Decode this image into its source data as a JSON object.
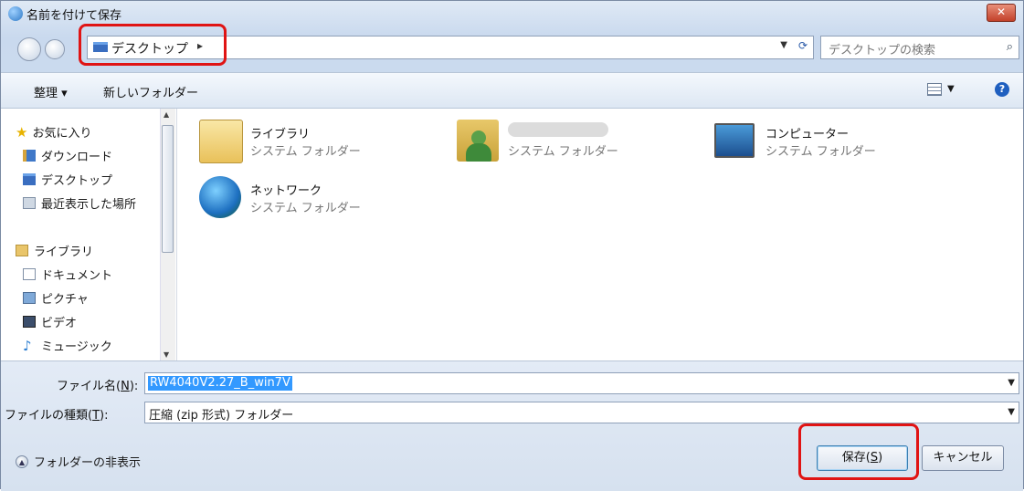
{
  "window": {
    "title": "名前を付けて保存",
    "close_label": "✕"
  },
  "navbar": {
    "address": "デスクトップ",
    "address_arrow": "▸",
    "search_placeholder": "デスクトップの検索"
  },
  "toolbar": {
    "organize": "整理 ▾",
    "new_folder": "新しいフォルダー"
  },
  "sidebar": {
    "favorites": "お気に入り",
    "items": [
      "ダウンロード",
      "デスクトップ",
      "最近表示した場所"
    ],
    "libraries": "ライブラリ",
    "library_items": [
      "ドキュメント",
      "ピクチャ",
      "ビデオ",
      "ミュージック"
    ]
  },
  "content": {
    "items": [
      {
        "name": "ライブラリ",
        "sub": "システム フォルダー",
        "icon": "library-folder-icon"
      },
      {
        "name": "",
        "sub": "システム フォルダー",
        "icon": "user-folder-icon"
      },
      {
        "name": "コンピューター",
        "sub": "システム フォルダー",
        "icon": "computer-icon"
      },
      {
        "name": "ネットワーク",
        "sub": "システム フォルダー",
        "icon": "network-icon"
      }
    ]
  },
  "form": {
    "filename_label_pre": "ファイル名(",
    "filename_label_key": "N",
    "filename_label_post": "):",
    "filename_value": "RW4040V2.27_B_win7V",
    "filetype_label_pre": "ファイルの種類(",
    "filetype_label_key": "T",
    "filetype_label_post": "):",
    "filetype_value": "圧縮 (zip 形式) フォルダー"
  },
  "footer": {
    "hide_folders": "フォルダーの非表示",
    "save_pre": "保存(",
    "save_key": "S",
    "save_post": ")",
    "cancel": "キャンセル"
  },
  "colors": {
    "highlight": "#e01414",
    "selection": "#3399ff"
  }
}
